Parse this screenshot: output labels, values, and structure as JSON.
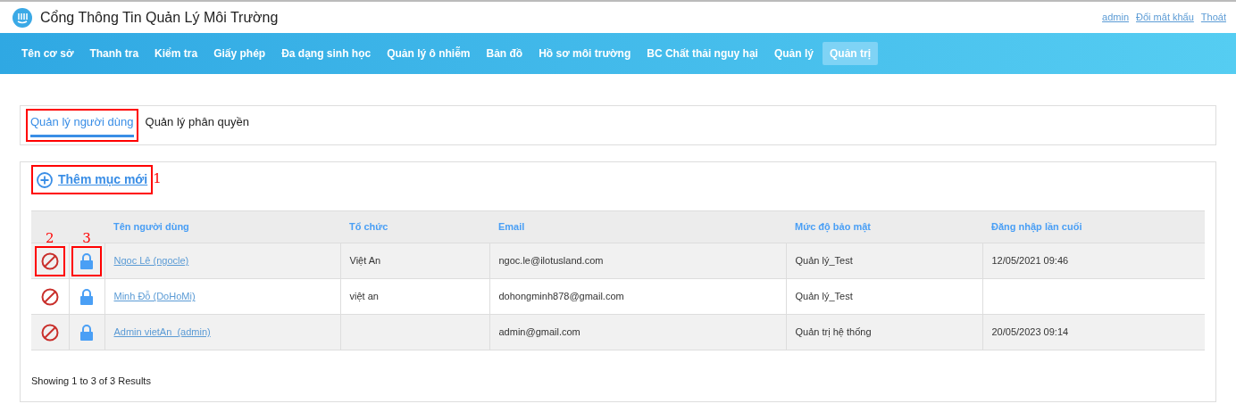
{
  "header": {
    "title": "Cổng Thông Tin Quản Lý Môi Trường",
    "links": [
      "admin",
      "Đổi mật khẩu",
      "Thoát"
    ]
  },
  "nav": [
    {
      "label": "Tên cơ sở",
      "selected": false
    },
    {
      "label": "Thanh tra",
      "selected": false
    },
    {
      "label": "Kiểm tra",
      "selected": false
    },
    {
      "label": "Giấy phép",
      "selected": false
    },
    {
      "label": "Đa dạng sinh học",
      "selected": false
    },
    {
      "label": "Quản lý ô nhiễm",
      "selected": false
    },
    {
      "label": "Bản đồ",
      "selected": false
    },
    {
      "label": "Hồ sơ môi trường",
      "selected": false
    },
    {
      "label": "BC Chất thải nguy hại",
      "selected": false
    },
    {
      "label": "Quản lý",
      "selected": false
    },
    {
      "label": "Quản trị",
      "selected": true
    }
  ],
  "tabs": [
    {
      "label": "Quản lý người dùng",
      "selected": true,
      "highlighted": true
    },
    {
      "label": "Quản lý phân quyền",
      "selected": false,
      "highlighted": false
    }
  ],
  "add_button": {
    "label": "Thêm mục mới",
    "highlighted": true,
    "marker": "1"
  },
  "table": {
    "columns": [
      "Tên người dùng",
      "Tổ chức",
      "Email",
      "Mức độ bảo mật",
      "Đăng nhập lần cuối"
    ],
    "rows": [
      {
        "name": "Ngoc Lê (ngocle)",
        "org": "Việt An",
        "email": "ngoc.le@ilotusland.com",
        "level": "Quản lý_Test",
        "last_login": "12/05/2021 09:46",
        "block_marker": "2",
        "lock_marker": "3"
      },
      {
        "name": "Minh Đỗ (DoHoMi)",
        "org": "việt an",
        "email": "dohongminh878@gmail.com",
        "level": "Quản lý_Test"
      },
      {
        "name": "Admin vietAn  (admin)",
        "email": "admin@gmail.com",
        "level": "Quản trị hệ thống",
        "last_login": "20/05/2023 09:14"
      }
    ]
  },
  "footer": "Showing 1 to 3 of 3 Results"
}
